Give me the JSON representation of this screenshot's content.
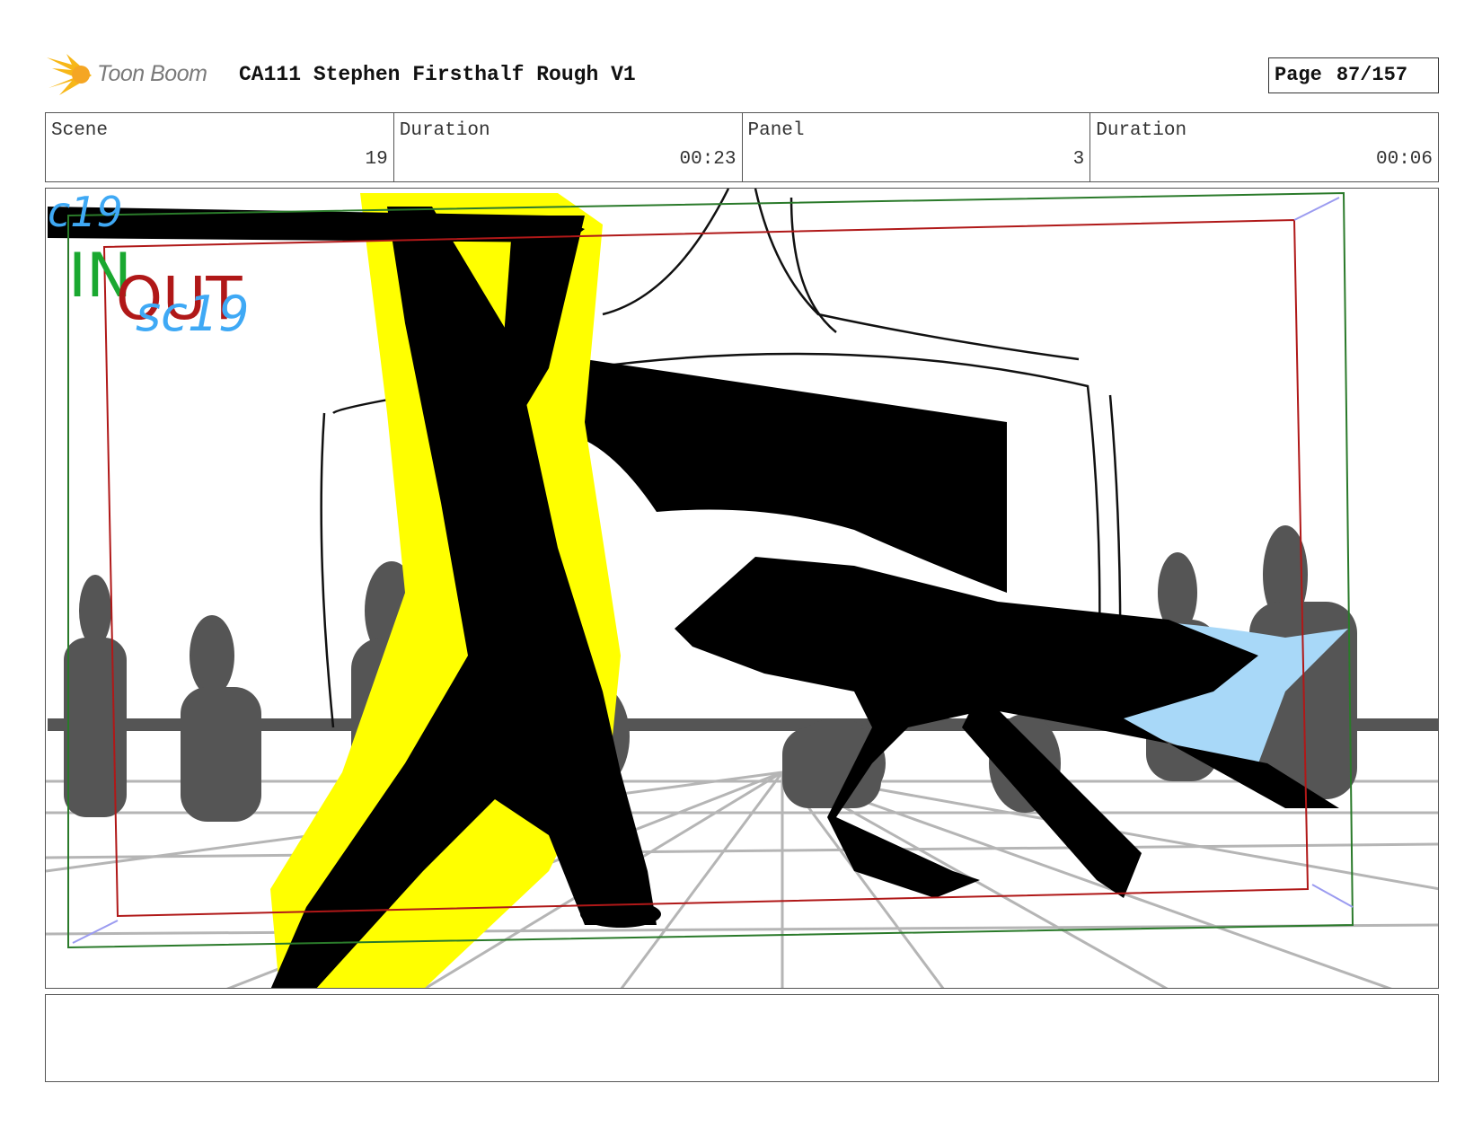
{
  "brand": {
    "name": "Toon Boom",
    "icon": "toon-boom-logo-icon",
    "accent": "#f7b718"
  },
  "document": {
    "title": "CA111 Stephen Firsthalf Rough V1"
  },
  "page": {
    "label": "Page",
    "value": "87/157"
  },
  "info": {
    "scene_label": "Scene",
    "scene_value": "19",
    "scene_duration_label": "Duration",
    "scene_duration_value": "00:23",
    "panel_label": "Panel",
    "panel_value": "3",
    "panel_duration_label": "Duration",
    "panel_duration_value": "00:06"
  },
  "panel_image": {
    "annotations": {
      "scene_mark": "c19",
      "in_mark": "IN",
      "out_mark": "OUT",
      "sub_mark": "sc19"
    },
    "colors": {
      "in": "#1aa830",
      "out": "#b01818",
      "sub": "#3fa9f5",
      "highlight": "#ffff00",
      "cape": "#a8d8f8",
      "crowd": "#555555"
    }
  },
  "notes": {
    "text": ""
  }
}
